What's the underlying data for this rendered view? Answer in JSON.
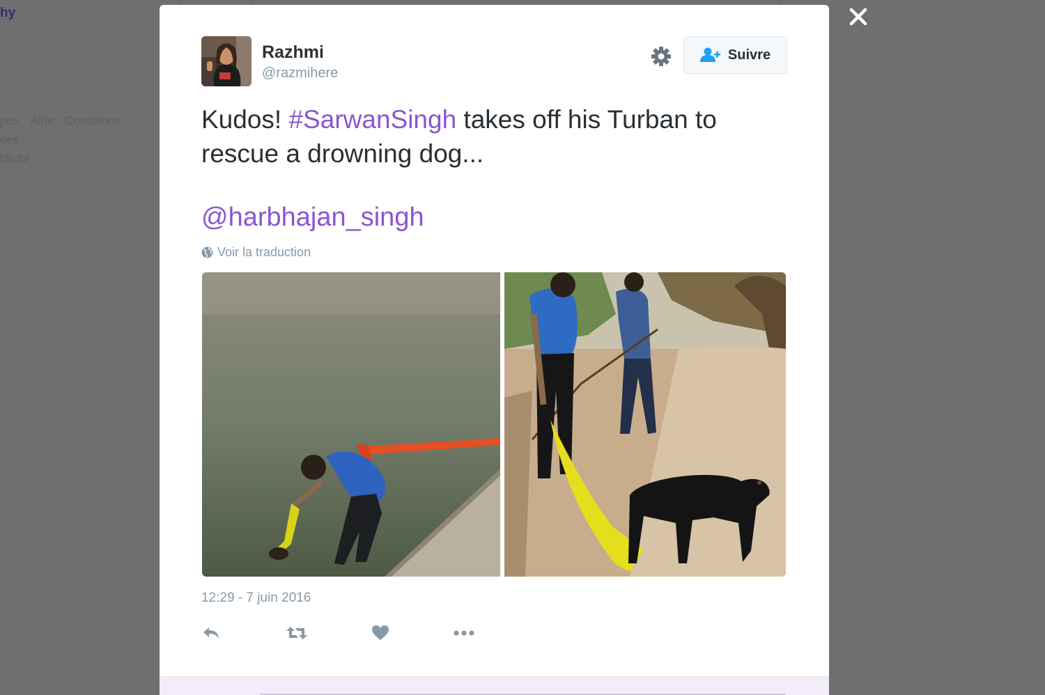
{
  "background": {
    "title_fragment": "hy",
    "footer_links": [
      "pos",
      "Aide",
      "Conditions",
      "des",
      "blicité"
    ]
  },
  "tweet": {
    "user": {
      "name": "Razhmi",
      "handle": "@razmihere"
    },
    "follow_label": "Suivre",
    "text_prefix": "Kudos! ",
    "hashtag": "#SarwanSingh",
    "text_suffix": " takes off his Turban to rescue a drowning dog...",
    "mention": "@harbhajan_singh",
    "translate_label": "Voir la traduction",
    "timestamp": "12:29 - 7 juin 2016"
  },
  "colors": {
    "link": "#8a56d1",
    "follow_icon": "#1da1f2",
    "muted": "#8899a6",
    "text": "#292f33"
  },
  "icons": [
    "close-icon",
    "gear-icon",
    "follow-person-icon",
    "globe-icon",
    "reply-icon",
    "retweet-icon",
    "like-icon",
    "more-icon"
  ]
}
